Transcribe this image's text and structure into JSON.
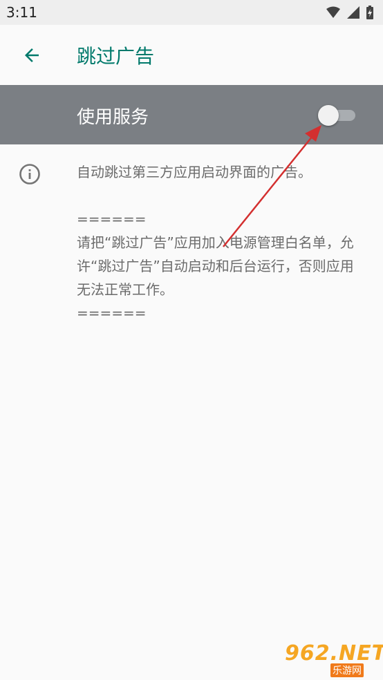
{
  "status_bar": {
    "time": "3:11",
    "icons": [
      "wifi-icon",
      "signal-icon",
      "battery-charging-icon"
    ]
  },
  "app_bar": {
    "back_icon": "arrow-left-icon",
    "title": "跳过广告"
  },
  "master_switch": {
    "label": "使用服务",
    "checked": false
  },
  "info": {
    "icon": "info-icon",
    "text": "自动跳过第三方应用启动界面的广告。\n\n======\n请把“跳过广告”应用加入电源管理白名单，允许“跳过广告”自动启动和后台运行，否则应用无法正常工作。\n======"
  },
  "watermark": {
    "logo": "962.NET",
    "sub": "乐游网"
  },
  "colors": {
    "accent": "#00796b",
    "switch_bar": "#7b7f84",
    "annotation_arrow": "#d32f2f"
  }
}
